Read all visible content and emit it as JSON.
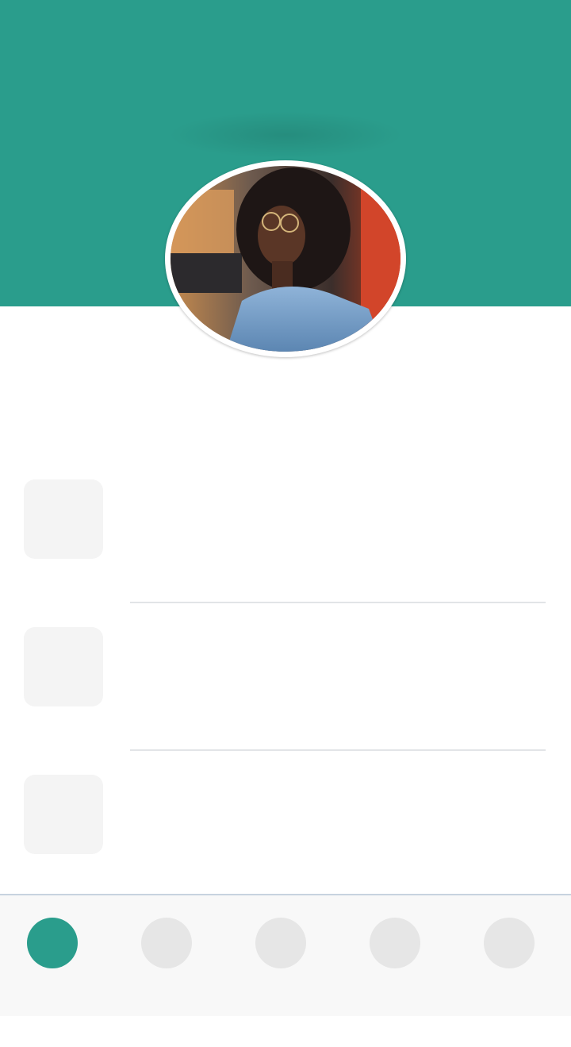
{
  "colors": {
    "accent": "#2a9d8c",
    "background": "#ffffff",
    "placeholder": "#f4f4f4",
    "divider": "#e2e4e7",
    "nav_background": "#f8f8f8",
    "nav_border": "#c7d3df",
    "nav_inactive": "#e6e6e6"
  },
  "profile": {
    "avatar_icon": "profile-photo"
  },
  "list": {
    "items": [
      {
        "icon": "placeholder-thumbnail"
      },
      {
        "icon": "placeholder-thumbnail"
      },
      {
        "icon": "placeholder-thumbnail"
      }
    ]
  },
  "bottom_nav": {
    "active_index": 0,
    "items": [
      {
        "icon": "nav-icon-1"
      },
      {
        "icon": "nav-icon-2"
      },
      {
        "icon": "nav-icon-3"
      },
      {
        "icon": "nav-icon-4"
      },
      {
        "icon": "nav-icon-5"
      }
    ]
  }
}
